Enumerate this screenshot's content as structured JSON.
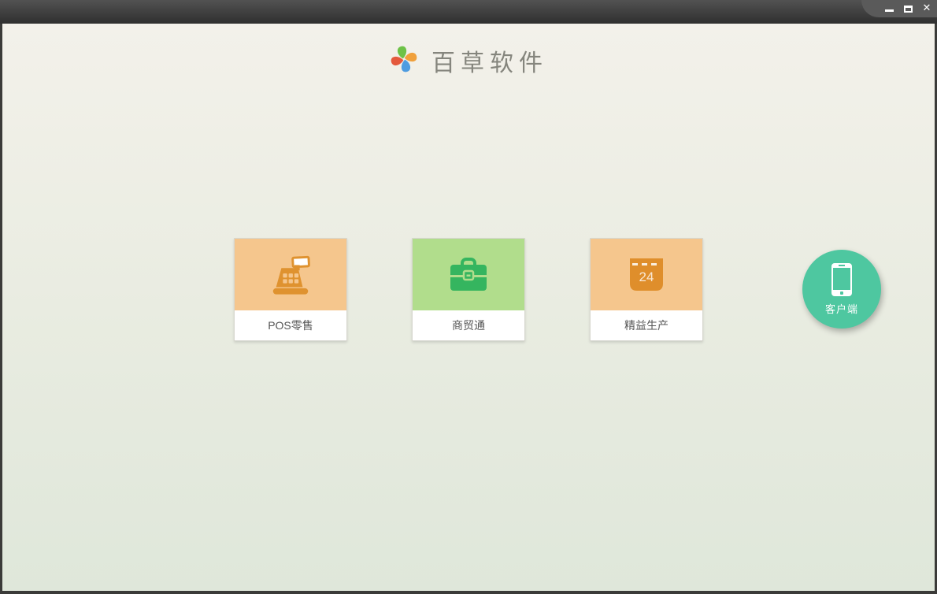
{
  "window": {
    "titlebar": {
      "controls": [
        {
          "name": "minimize"
        },
        {
          "name": "maximize"
        },
        {
          "name": "close",
          "glyph": "✕"
        }
      ]
    }
  },
  "brand": {
    "title": "百草软件",
    "logo": "pinwheel-logo",
    "logo_colors": {
      "top": "#6dc247",
      "right": "#f0a03c",
      "bottom": "#4e9ce0",
      "left": "#e4593c"
    }
  },
  "products": [
    {
      "label": "POS零售",
      "icon": "cash-register-icon",
      "tile_color": "#f5c68d",
      "icon_color": "#df922f"
    },
    {
      "label": "商贸通",
      "icon": "briefcase-icon",
      "tile_color": "#b1dd8c",
      "icon_color": "#35b55f"
    },
    {
      "label": "精益生产",
      "icon": "calendar-icon",
      "icon_text": "24",
      "tile_color": "#f5c68d",
      "icon_color": "#df8e2b"
    }
  ],
  "client_button": {
    "label": "客户端",
    "icon": "smartphone-icon",
    "color": "#4ec7a0"
  },
  "theme": {
    "titlebar_top": "#525252",
    "titlebar_bottom": "#2f2f2f",
    "frame_border": "#3b3b39",
    "background_top": "#f3f1ea",
    "background_bottom": "#dfe7da",
    "card_label_color": "#555555",
    "brand_title_color": "#85857d"
  }
}
